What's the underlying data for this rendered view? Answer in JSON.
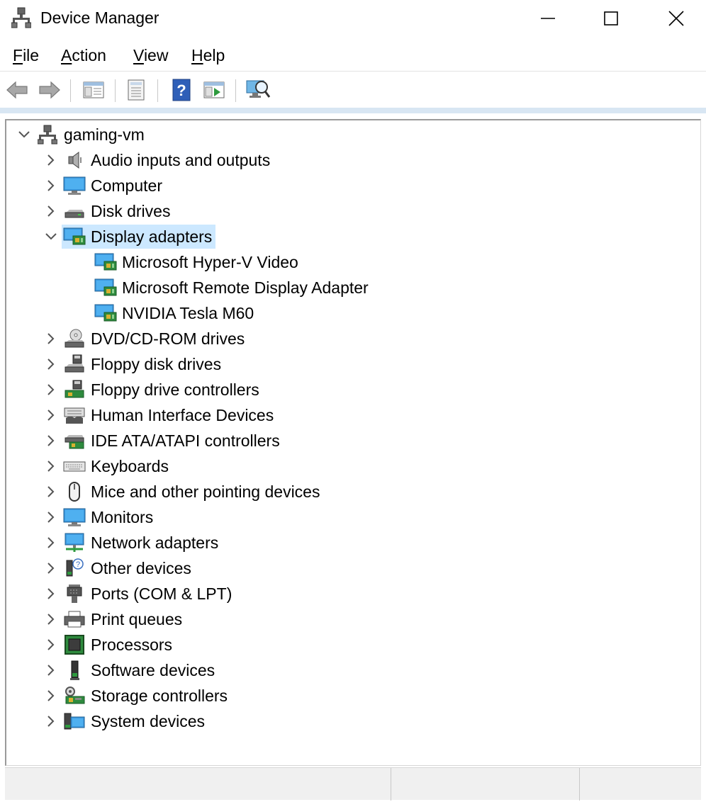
{
  "window": {
    "title": "Device Manager",
    "icon": "device-manager-icon",
    "controls": {
      "minimize": "minimize-icon",
      "maximize": "maximize-icon",
      "close": "close-icon"
    }
  },
  "menu": {
    "items": [
      {
        "label": "File",
        "mnemonic": "F",
        "rest": "ile"
      },
      {
        "label": "Action",
        "mnemonic": "A",
        "rest": "ction"
      },
      {
        "label": "View",
        "mnemonic": "V",
        "rest": "iew"
      },
      {
        "label": "Help",
        "mnemonic": "H",
        "rest": "elp"
      }
    ]
  },
  "toolbar": {
    "buttons": [
      "back-arrow-icon",
      "forward-arrow-icon",
      "show-hide-console-tree-icon",
      "properties-icon",
      "help-icon",
      "run-icon",
      "scan-hardware-changes-icon"
    ]
  },
  "tree": {
    "root": {
      "label": "gaming-vm",
      "icon": "computer-tower-icon",
      "expanded": true
    },
    "categories": [
      {
        "label": "Audio inputs and outputs",
        "icon": "speaker-icon",
        "expanded": false
      },
      {
        "label": "Computer",
        "icon": "monitor-icon",
        "expanded": false
      },
      {
        "label": "Disk drives",
        "icon": "disk-drive-icon",
        "expanded": false
      },
      {
        "label": "Display adapters",
        "icon": "display-adapter-icon",
        "expanded": true,
        "selected": true,
        "children": [
          {
            "label": "Microsoft Hyper-V Video",
            "icon": "display-adapter-icon"
          },
          {
            "label": "Microsoft Remote Display Adapter",
            "icon": "display-adapter-icon"
          },
          {
            "label": "NVIDIA Tesla M60",
            "icon": "display-adapter-icon"
          }
        ]
      },
      {
        "label": "DVD/CD-ROM drives",
        "icon": "dvd-drive-icon",
        "expanded": false
      },
      {
        "label": "Floppy disk drives",
        "icon": "floppy-drive-icon",
        "expanded": false
      },
      {
        "label": "Floppy drive controllers",
        "icon": "floppy-controller-icon",
        "expanded": false
      },
      {
        "label": "Human Interface Devices",
        "icon": "hid-icon",
        "expanded": false
      },
      {
        "label": "IDE ATA/ATAPI controllers",
        "icon": "ide-controller-icon",
        "expanded": false
      },
      {
        "label": "Keyboards",
        "icon": "keyboard-icon",
        "expanded": false
      },
      {
        "label": "Mice and other pointing devices",
        "icon": "mouse-icon",
        "expanded": false
      },
      {
        "label": "Monitors",
        "icon": "monitor-icon",
        "expanded": false
      },
      {
        "label": "Network adapters",
        "icon": "network-adapter-icon",
        "expanded": false
      },
      {
        "label": "Other devices",
        "icon": "unknown-device-icon",
        "expanded": false
      },
      {
        "label": "Ports (COM & LPT)",
        "icon": "port-icon",
        "expanded": false
      },
      {
        "label": "Print queues",
        "icon": "printer-icon",
        "expanded": false
      },
      {
        "label": "Processors",
        "icon": "processor-icon",
        "expanded": false
      },
      {
        "label": "Software devices",
        "icon": "software-device-icon",
        "expanded": false
      },
      {
        "label": "Storage controllers",
        "icon": "storage-controller-icon",
        "expanded": false
      },
      {
        "label": "System devices",
        "icon": "system-devices-icon",
        "expanded": false
      }
    ]
  },
  "colors": {
    "selection": "#cce8ff",
    "toolbar_accent": "#d8e6f3",
    "chevron": "#555555"
  }
}
